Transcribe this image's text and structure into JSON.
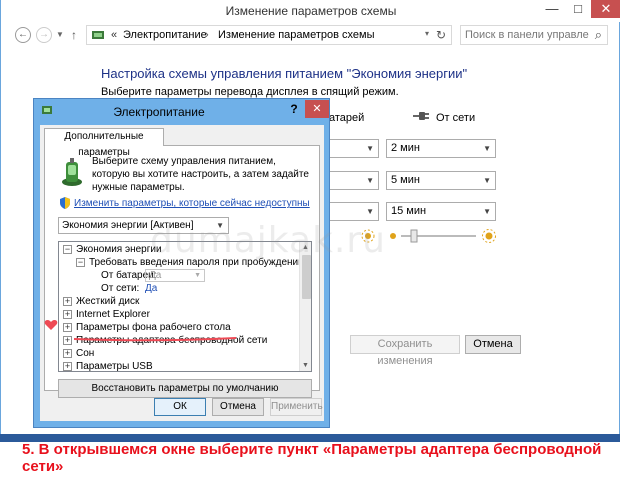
{
  "window": {
    "title": "Изменение параметров схемы",
    "min_glyph": "—",
    "max_glyph": "□",
    "close_glyph": "✕"
  },
  "nav": {
    "back_glyph": "←",
    "forward_glyph": "→",
    "dropdown_glyph": "▼",
    "up_glyph": "↑"
  },
  "address": {
    "separator": "«",
    "crumb1": "Электропитание",
    "arrow": "›",
    "crumb2": "Изменение параметров схемы",
    "dropdown_glyph": "▾",
    "refresh_glyph": "↻"
  },
  "search": {
    "placeholder": "Поиск в панели управления",
    "icon": "search-icon"
  },
  "main": {
    "heading": "Настройка схемы управления питанием \"Экономия энергии\"",
    "subtext": "Выберите параметры перевода дисплея в спящий режим.",
    "col_battery": "атарей",
    "col_ac": "От сети",
    "rows": [
      {
        "ac_value": "2 мин"
      },
      {
        "ac_value": "5 мин"
      },
      {
        "ac_value": "15 мин"
      }
    ],
    "save_button": "Сохранить изменения",
    "cancel_button": "Отмена"
  },
  "dialog": {
    "title": "Электропитание",
    "help_glyph": "?",
    "close_glyph": "✕",
    "tab": "Дополнительные параметры",
    "description": "Выберите схему управления питанием, которую вы хотите настроить, а затем задайте нужные параметры.",
    "change_link": "Изменить параметры, которые сейчас недоступны",
    "plan_selected": "Экономия энергии [Активен]",
    "tree": [
      {
        "label": "Экономия энергии",
        "expander": "⊟"
      },
      {
        "label": "Требовать введения пароля при пробуждении",
        "expander": "⊟"
      },
      {
        "label": "От батареи:",
        "value": "Да"
      },
      {
        "label": "От сети:",
        "value": "Да"
      },
      {
        "label": "Жесткий диск",
        "expander": "+"
      },
      {
        "label": "Internet Explorer",
        "expander": "+"
      },
      {
        "label": "Параметры фона рабочего стола",
        "expander": "+"
      },
      {
        "label": "Параметры адаптера беспроводной сети",
        "expander": "+"
      },
      {
        "label": "Сон",
        "expander": "+"
      },
      {
        "label": "Параметры USB",
        "expander": "+"
      }
    ],
    "restore_button": "Восстановить параметры по умолчанию",
    "ok_button": "ОК",
    "cancel_button": "Отмена",
    "apply_button": "Применить"
  },
  "watermark": "dumajkak.ru",
  "caption": "5. В открывшемся окне выберите пункт «Параметры адаптера беспроводной сети»",
  "colors": {
    "accent_blue": "#1e3287",
    "link_blue": "#1f4fb5",
    "dialog_frame": "#6fb0e8",
    "close_red": "#c75050",
    "caption_red": "#e8101c"
  }
}
